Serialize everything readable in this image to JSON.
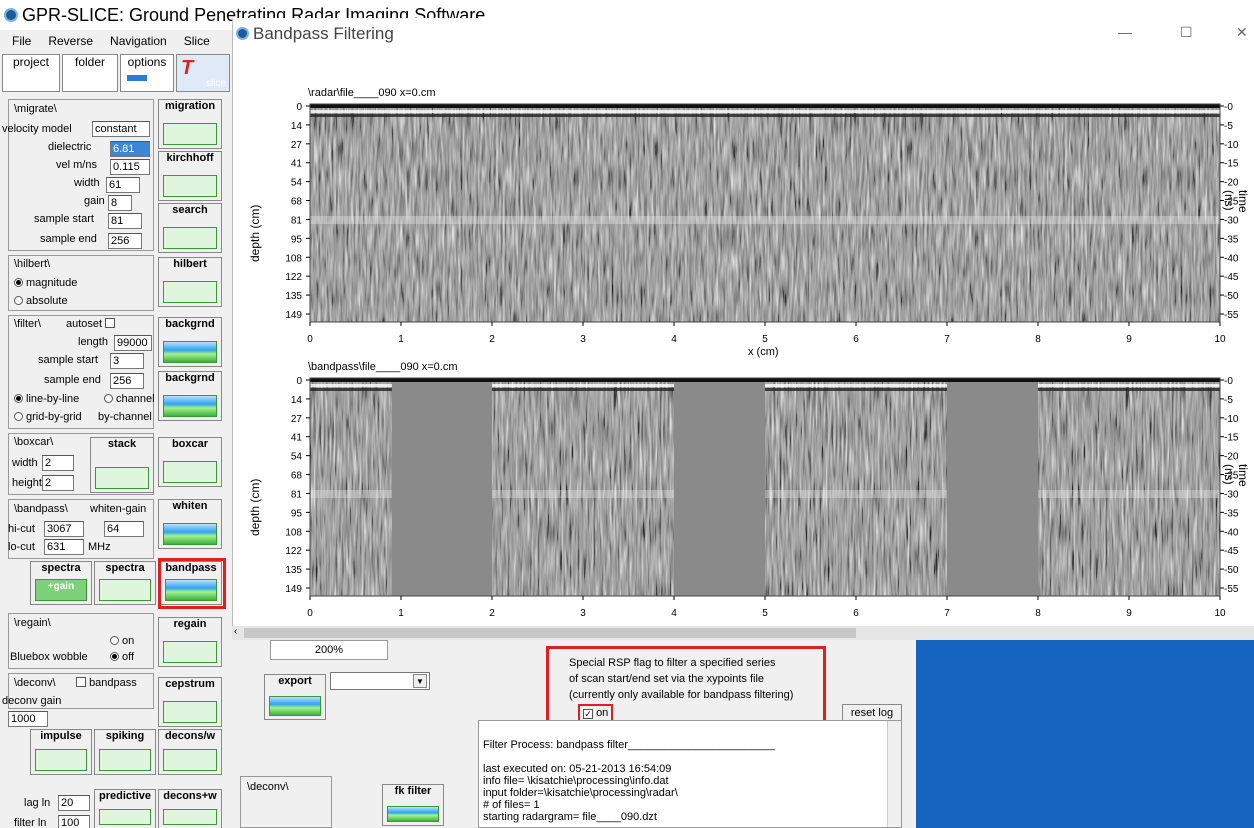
{
  "app": {
    "title": "GPR-SLICE:   Ground Penetrating Radar Imaging Software",
    "menu": [
      "File",
      "Reverse",
      "Navigation",
      "Slice"
    ],
    "top_buttons": {
      "project": "project",
      "folder": "folder",
      "options": "options",
      "slice": "slice"
    }
  },
  "migrate": {
    "header": "\\migrate\\",
    "velocity_model_label": "velocity model",
    "velocity_model": "constant",
    "dielectric_label": "dielectric",
    "dielectric": "6.81",
    "vel_label": "vel m/ns",
    "vel": "0.115",
    "width_label": "width",
    "width": "61",
    "gain_label": "gain",
    "gain": "8",
    "sample_start_label": "sample start",
    "sample_start": "81",
    "sample_end_label": "sample end",
    "sample_end": "256",
    "migration_btn": "migration",
    "kirchhoff_btn": "kirchhoff",
    "search_btn": "search"
  },
  "hilbert": {
    "header": "\\hilbert\\",
    "magnitude": "magnitude",
    "absolute": "absolute",
    "btn": "hilbert"
  },
  "filter": {
    "header": "\\filter\\",
    "autoset": "autoset",
    "length_label": "length",
    "length": "99000",
    "sample_start_label": "sample start",
    "sample_start": "3",
    "sample_end_label": "sample end",
    "sample_end": "256",
    "line_by_line": "line-by-line",
    "channel": "channel",
    "grid_by_grid": "grid-by-grid",
    "by_channel": "by-channel",
    "backgrnd1": "backgrnd",
    "backgrnd2": "backgrnd"
  },
  "boxcar": {
    "header": "\\boxcar\\",
    "width_label": "width",
    "width": "2",
    "height_label": "height",
    "height": "2",
    "stack_btn": "stack",
    "boxcar_btn": "boxcar"
  },
  "bandpass": {
    "header": "\\bandpass\\",
    "whiten_gain_label": "whiten-gain",
    "whiten_gain": "64",
    "hicut_label": "hi-cut",
    "hicut": "3067",
    "locut_label": "lo-cut",
    "locut": "631",
    "mhz": "MHz",
    "whiten_btn": "whiten",
    "spectra_gain_btn": "spectra",
    "spectra_gain_sub": "+gain",
    "spectra_btn": "spectra",
    "bandpass_btn": "bandpass"
  },
  "regain": {
    "header": "\\regain\\",
    "on": "on",
    "off": "off",
    "bluebox": "Bluebox wobble",
    "btn": "regain"
  },
  "deconv": {
    "header": "\\deconv\\",
    "bandpass": "bandpass",
    "deconv_gain_label": "deconv gain",
    "deconv_gain": "1000",
    "cepstrum_btn": "cepstrum",
    "impulse_btn": "impulse",
    "spiking_btn": "spiking",
    "decons_w_btn": "decons/w",
    "lag_label": "lag ln",
    "lag": "20",
    "filter_label": "filter ln",
    "filter": "100",
    "predictive_btn": "predictive",
    "decons_w2_btn": "decons+w"
  },
  "bp_window": {
    "title": "Bandpass Filtering",
    "controls": {
      "min": "—",
      "max": "☐",
      "close": "✕"
    },
    "plot1_title": "\\radar\\file____090  x=0.cm",
    "plot2_title": "\\bandpass\\file____090  x=0.cm",
    "ylabel": "depth (cm)",
    "y2label": "time (ns)",
    "xlabel": "x (cm)",
    "depth_ticks": [
      "0",
      "14",
      "27",
      "41",
      "54",
      "68",
      "81",
      "95",
      "108",
      "122",
      "135",
      "149"
    ],
    "time_ticks": [
      "-0",
      "-5",
      "-10",
      "-15",
      "-20",
      "-25",
      "-30",
      "-35",
      "-40",
      "-45",
      "-50",
      "-55"
    ],
    "x_ticks": [
      "0",
      "1",
      "2",
      "3",
      "4",
      "5",
      "6",
      "7",
      "8",
      "9",
      "10"
    ]
  },
  "bottom": {
    "zoom": "200%",
    "export_btn": "export",
    "rsp_text": [
      "Special RSP flag to filter a specified series",
      "of scan start/end set via the xypoints file",
      "(currently only available for bandpass filtering)"
    ],
    "on_label": "on",
    "reset_log_btn": "reset log",
    "deconv_label": "\\deconv\\",
    "fk_filter_btn": "fk filter",
    "log_lines": [
      "Filter Process:  bandpass filter________________________",
      "",
      "last executed on:          05-21-2013  16:54:09",
      "info file=   \\kisatchie\\processing\\info.dat",
      "input folder=\\kisatchie\\processing\\radar\\",
      "# of files=      1",
      "starting radargram=    file____090.dzt"
    ]
  },
  "colors": {
    "accent_red": "#e02020",
    "blue_panel": "#1565c0",
    "icon_green": "#3cb043"
  }
}
